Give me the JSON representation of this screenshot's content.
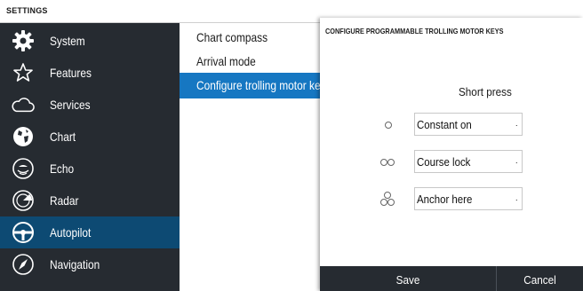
{
  "header": {
    "title": "SETTINGS"
  },
  "sidebar": {
    "items": [
      {
        "label": "System",
        "icon": "gear-icon"
      },
      {
        "label": "Features",
        "icon": "star-icon"
      },
      {
        "label": "Services",
        "icon": "cloud-icon"
      },
      {
        "label": "Chart",
        "icon": "globe-icon"
      },
      {
        "label": "Echo",
        "icon": "echo-icon"
      },
      {
        "label": "Radar",
        "icon": "radar-icon"
      },
      {
        "label": "Autopilot",
        "icon": "steering-wheel-icon",
        "active": true
      },
      {
        "label": "Navigation",
        "icon": "compass-icon"
      }
    ]
  },
  "content": {
    "items": [
      {
        "label": "Chart compass"
      },
      {
        "label": "Arrival mode"
      },
      {
        "label": "Configure trolling motor keys",
        "selected": true
      }
    ]
  },
  "dialog": {
    "title": "CONFIGURE PROGRAMMABLE TROLLING MOTOR KEYS",
    "column_header": "Short press",
    "rows": [
      {
        "key_icon": "single-circle-icon",
        "value": "Constant on"
      },
      {
        "key_icon": "double-circle-icon",
        "value": "Course lock"
      },
      {
        "key_icon": "triple-circle-icon",
        "value": "Anchor here"
      }
    ],
    "save_label": "Save",
    "cancel_label": "Cancel"
  },
  "colors": {
    "sidebar_bg": "#262b31",
    "active_bg": "#0d4a73",
    "selected_bg": "#1677c2"
  }
}
